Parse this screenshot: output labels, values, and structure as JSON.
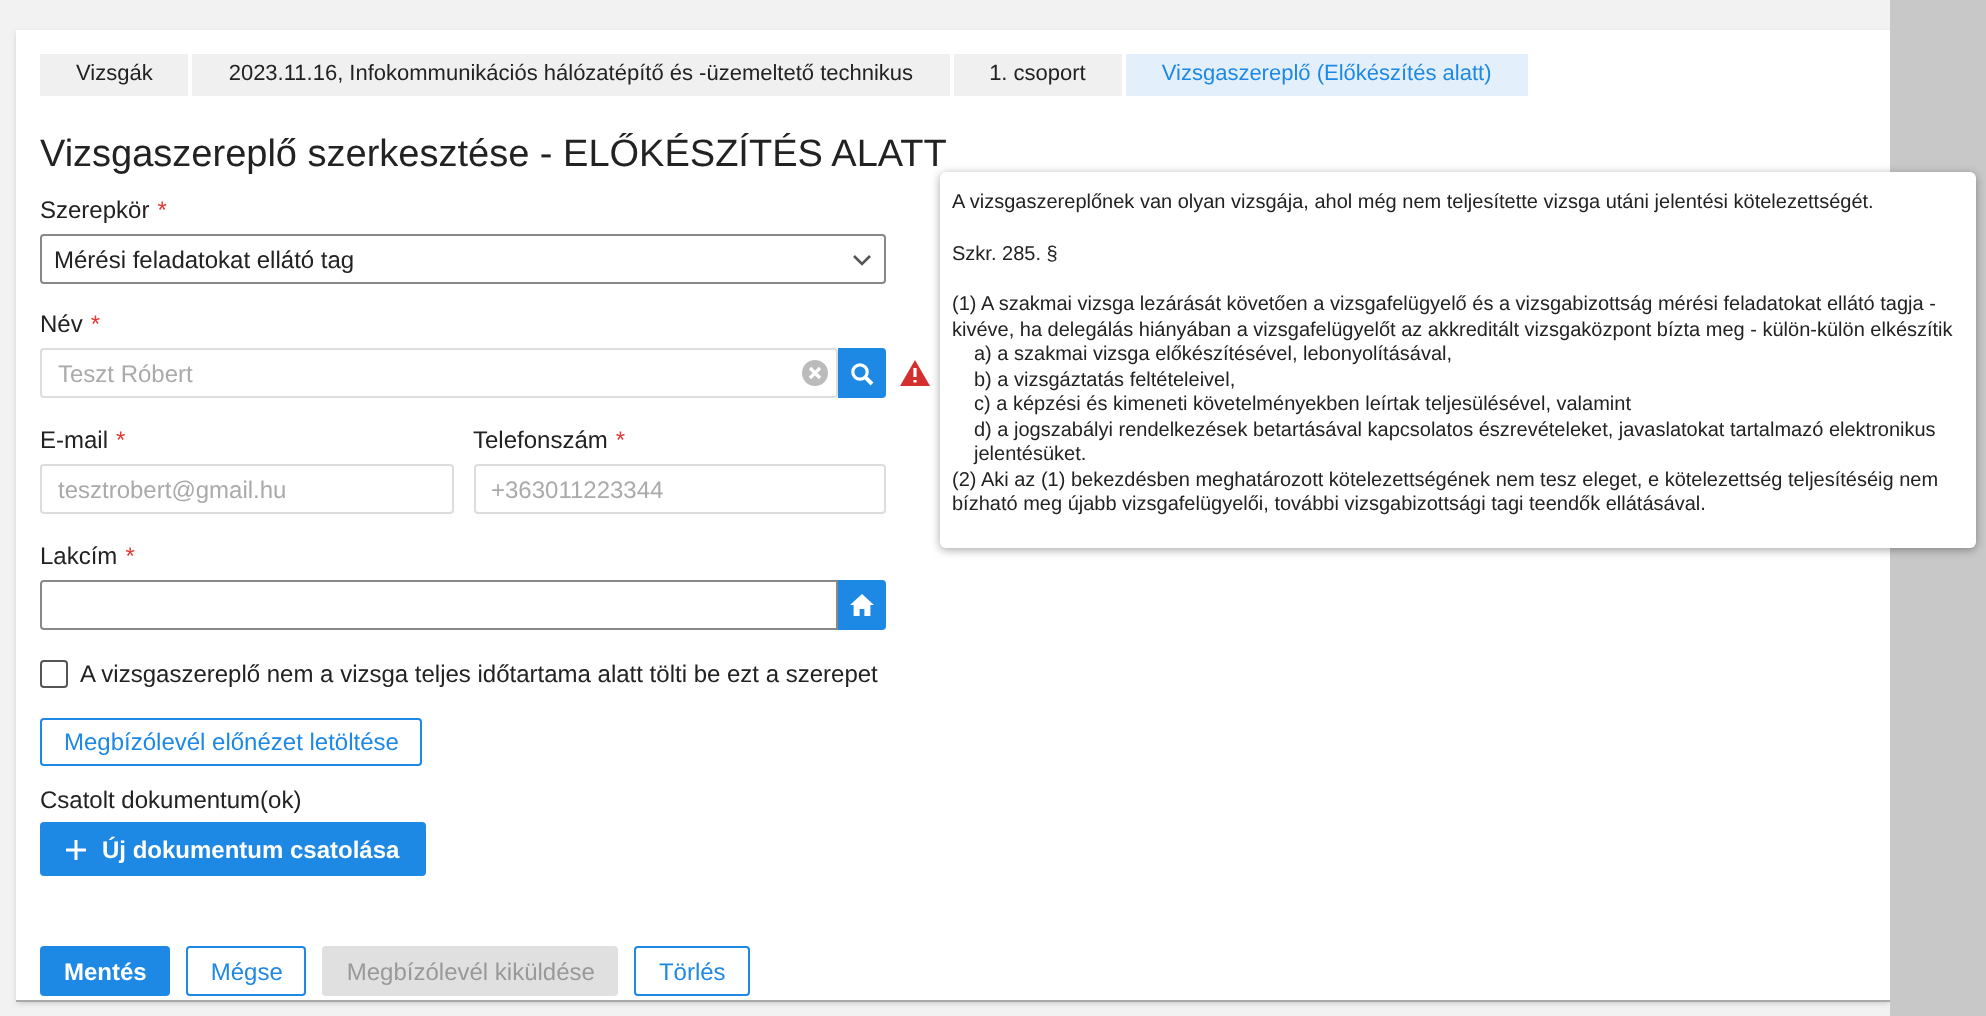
{
  "breadcrumbs": [
    {
      "label": "Vizsgák",
      "selected": false
    },
    {
      "label": "2023.11.16, Infokommunikációs hálózatépítő és -üzemeltető technikus",
      "selected": false
    },
    {
      "label": "1. csoport",
      "selected": false
    },
    {
      "label": "Vizsgaszereplő (Előkészítés alatt)",
      "selected": true
    }
  ],
  "title": "Vizsgaszereplő szerkesztése - ELŐKÉSZÍTÉS ALATT",
  "role": {
    "label": "Szerepkör",
    "required_mark": "*",
    "value": "Mérési feladatokat ellátó tag"
  },
  "name": {
    "label": "Név",
    "required_mark": "*",
    "placeholder": "Teszt Róbert",
    "warning": true
  },
  "email": {
    "label": "E-mail",
    "required_mark": "*",
    "placeholder": "tesztrobert@gmail.hu"
  },
  "phone": {
    "label": "Telefonszám",
    "required_mark": "*",
    "placeholder": "+363011223344"
  },
  "address": {
    "label": "Lakcím",
    "required_mark": "*"
  },
  "partial_checkbox": {
    "label": "A vizsgaszereplő nem a vizsga teljes időtartama alatt tölti be ezt a szerepet",
    "checked": false
  },
  "preview_button": "Megbízólevél előnézet letöltése",
  "attachments": {
    "label": "Csatolt dokumentum(ok)",
    "add_button": "Új dokumentum csatolása"
  },
  "actions": [
    {
      "label": "Mentés",
      "kind": "primary"
    },
    {
      "label": "Mégse",
      "kind": "outline"
    },
    {
      "label": "Megbízólevél kiküldése",
      "kind": "disabled"
    },
    {
      "label": "Törlés",
      "kind": "outline"
    }
  ],
  "tooltip": {
    "lines": [
      {
        "kind": "para",
        "text": "A vizsgaszereplőnek van olyan vizsgája, ahol még nem teljesítette vizsga utáni jelentési kötelezettségét."
      },
      {
        "kind": "para",
        "text": "Szkr. 285. §"
      },
      {
        "kind": "line",
        "text": "(1) A szakmai vizsga lezárását követően a vizsgafelügyelő és a vizsgabizottság mérési feladatokat ellátó tagja - kivéve, ha delegálás hiányában a vizsgafelügyelőt az akkreditált vizsgaközpont bízta meg - külön-külön elkészítik"
      },
      {
        "kind": "item",
        "text": "a) a szakmai vizsga előkészítésével, lebonyolításával,"
      },
      {
        "kind": "item",
        "text": "b) a vizsgáztatás feltételeivel,"
      },
      {
        "kind": "item",
        "text": "c) a képzési és kimeneti követelményekben leírtak teljesülésével, valamint"
      },
      {
        "kind": "item",
        "text": "d) a jogszabályi rendelkezések betartásával kapcsolatos észrevételeket, javaslatokat tartalmazó elektronikus jelentésüket."
      },
      {
        "kind": "line",
        "text": "(2) Aki az (1) bekezdésben meghatározott kötelezettségének nem tesz eleget, e kötelezettség teljesítéséig nem bízható meg újabb vizsgafelügyelői, további vizsgabizottsági tagi teendők ellátásával."
      }
    ]
  }
}
